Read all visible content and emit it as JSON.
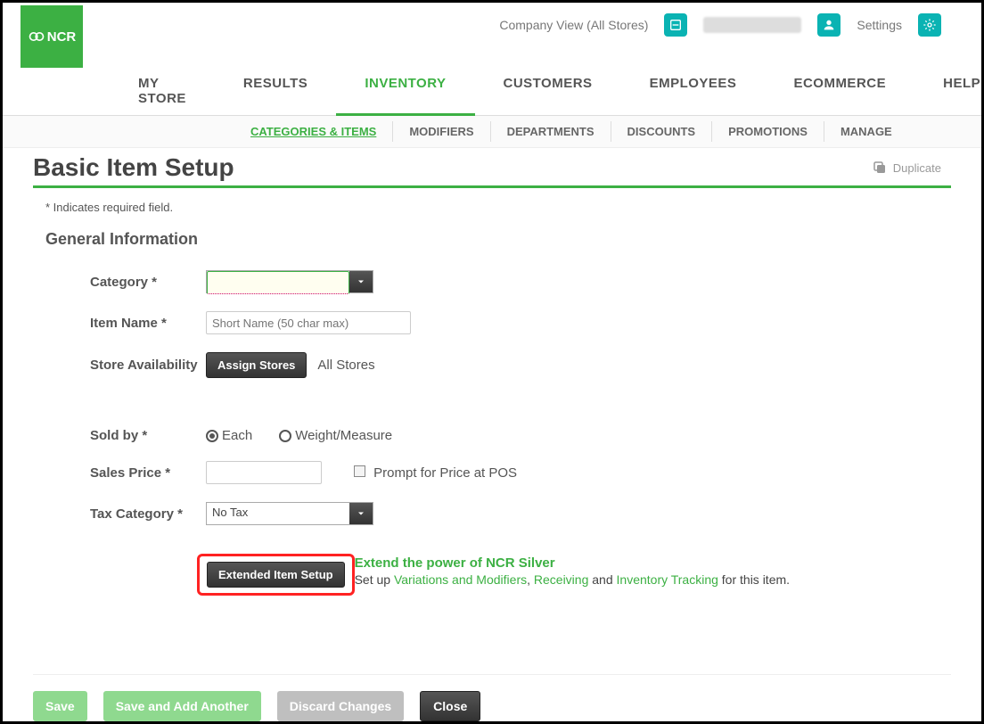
{
  "header": {
    "company_view": "Company View (All Stores)",
    "settings_label": "Settings"
  },
  "brand": "NCR",
  "main_nav": {
    "items": [
      "MY STORE",
      "RESULTS",
      "INVENTORY",
      "CUSTOMERS",
      "EMPLOYEES",
      "ECOMMERCE",
      "HELP"
    ],
    "active_index": 2
  },
  "sub_nav": {
    "items": [
      "CATEGORIES & ITEMS",
      "MODIFIERS",
      "DEPARTMENTS",
      "DISCOUNTS",
      "PROMOTIONS",
      "MANAGE"
    ],
    "active_index": 0
  },
  "page": {
    "title": "Basic Item Setup",
    "duplicate_label": "Duplicate",
    "required_note": "* Indicates required field.",
    "section_title": "General Information"
  },
  "form": {
    "category": {
      "label": "Category *",
      "value": ""
    },
    "item_name": {
      "label": "Item Name *",
      "placeholder": "Short Name (50 char max)",
      "value": ""
    },
    "store_availability": {
      "label": "Store Availability",
      "button": "Assign Stores",
      "text": "All Stores"
    },
    "sold_by": {
      "label": "Sold by *",
      "options": [
        "Each",
        "Weight/Measure"
      ],
      "selected": "Each"
    },
    "sales_price": {
      "label": "Sales Price *",
      "value": "",
      "checkbox_label": "Prompt for Price at POS",
      "checked": false
    },
    "tax_category": {
      "label": "Tax Category *",
      "value": "No Tax"
    },
    "extended": {
      "button": "Extended Item Setup",
      "headline": "Extend the power of NCR Silver",
      "prefix": "Set up ",
      "link1": "Variations and Modifiers",
      "mid1": ", ",
      "link2": "Receiving",
      "mid2": " and ",
      "link3": "Inventory Tracking",
      "suffix": " for this item."
    }
  },
  "footer": {
    "save": "Save",
    "save_add": "Save and Add Another",
    "discard": "Discard Changes",
    "close": "Close"
  }
}
